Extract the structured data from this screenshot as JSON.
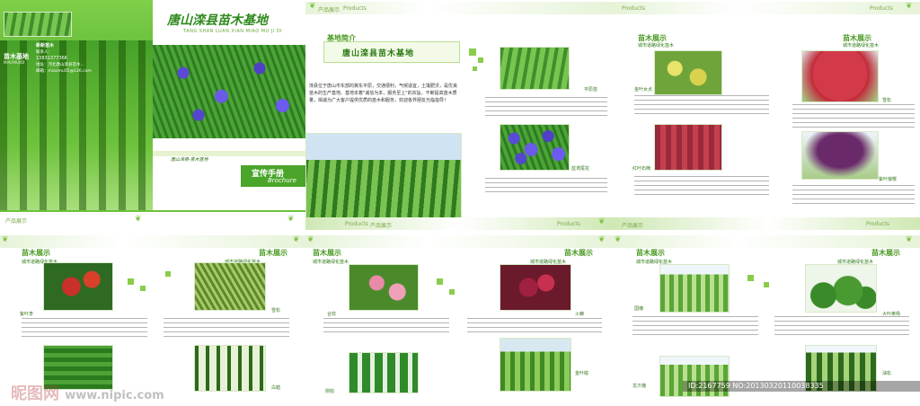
{
  "cover": {
    "title": "唐山滦县苗木基地",
    "title_pinyin": "TANG SHAN LUAN XIAN MIAO MU JI DI",
    "logo_text": "苗木基地",
    "logo_sub": "MIAOMUJIDI",
    "contact_company": "新新苗木",
    "contact_person": "联系人：",
    "contact_phone": "13831377366",
    "contact_addr": "地址：河北唐山滦县苗木…",
    "contact_email": "邮箱：miaomu55@126.com",
    "slogan": "唐山滦县·苗木基地",
    "brochure_cn": "宣传手册",
    "brochure_en": "Brochure"
  },
  "header": {
    "products_label": "Products",
    "products_cn": "产品展示"
  },
  "intro": {
    "section_tag": "基地简介",
    "heading": "唐山滦县苗木基地",
    "body": "滦县位于唐山市东部的冀东平原，交通便利，气候适宜，土壤肥沃，是优良苗木的生产基地。基地本着\"诚信为本，服务至上\"的宗旨，不断提高苗木质量，竭诚为广大客户提供优质的苗木和服务，欢迎各界朋友光临指导！"
  },
  "spread2": {
    "section_tag": "苗木展示",
    "subtitle": "城市道路绿化苗木",
    "captions": [
      "平原苗",
      "蓝鸢尾花",
      "金叶女贞",
      "红叶石楠",
      "紫叶李",
      "紫叶矮樱"
    ]
  },
  "spread3": {
    "section_tag": "苗木展示",
    "subtitle": "城市道路绿化苗木",
    "captions": [
      "红叶石楠",
      "雪松",
      "金叶女贞",
      "白蜡"
    ]
  },
  "spread4": {
    "section_tag": "苗木展示",
    "subtitle": "城市道路绿化苗木",
    "captions": [
      "合欢",
      "火棘",
      "侧柏",
      "金叶榆"
    ]
  },
  "spread5": {
    "section_tag": "苗木展示",
    "subtitle": "城市道路绿化苗木",
    "captions": [
      "国槐",
      "大叶黄杨",
      "龙爪槐",
      "油松"
    ]
  },
  "watermark": {
    "site_cn": "昵图网",
    "site_url": "www.nipic.com",
    "id_text": "ID:2167759 NO:20130320110038335"
  },
  "colors": {
    "primary_green": "#4a9a22",
    "light_green": "#8acc4a"
  }
}
